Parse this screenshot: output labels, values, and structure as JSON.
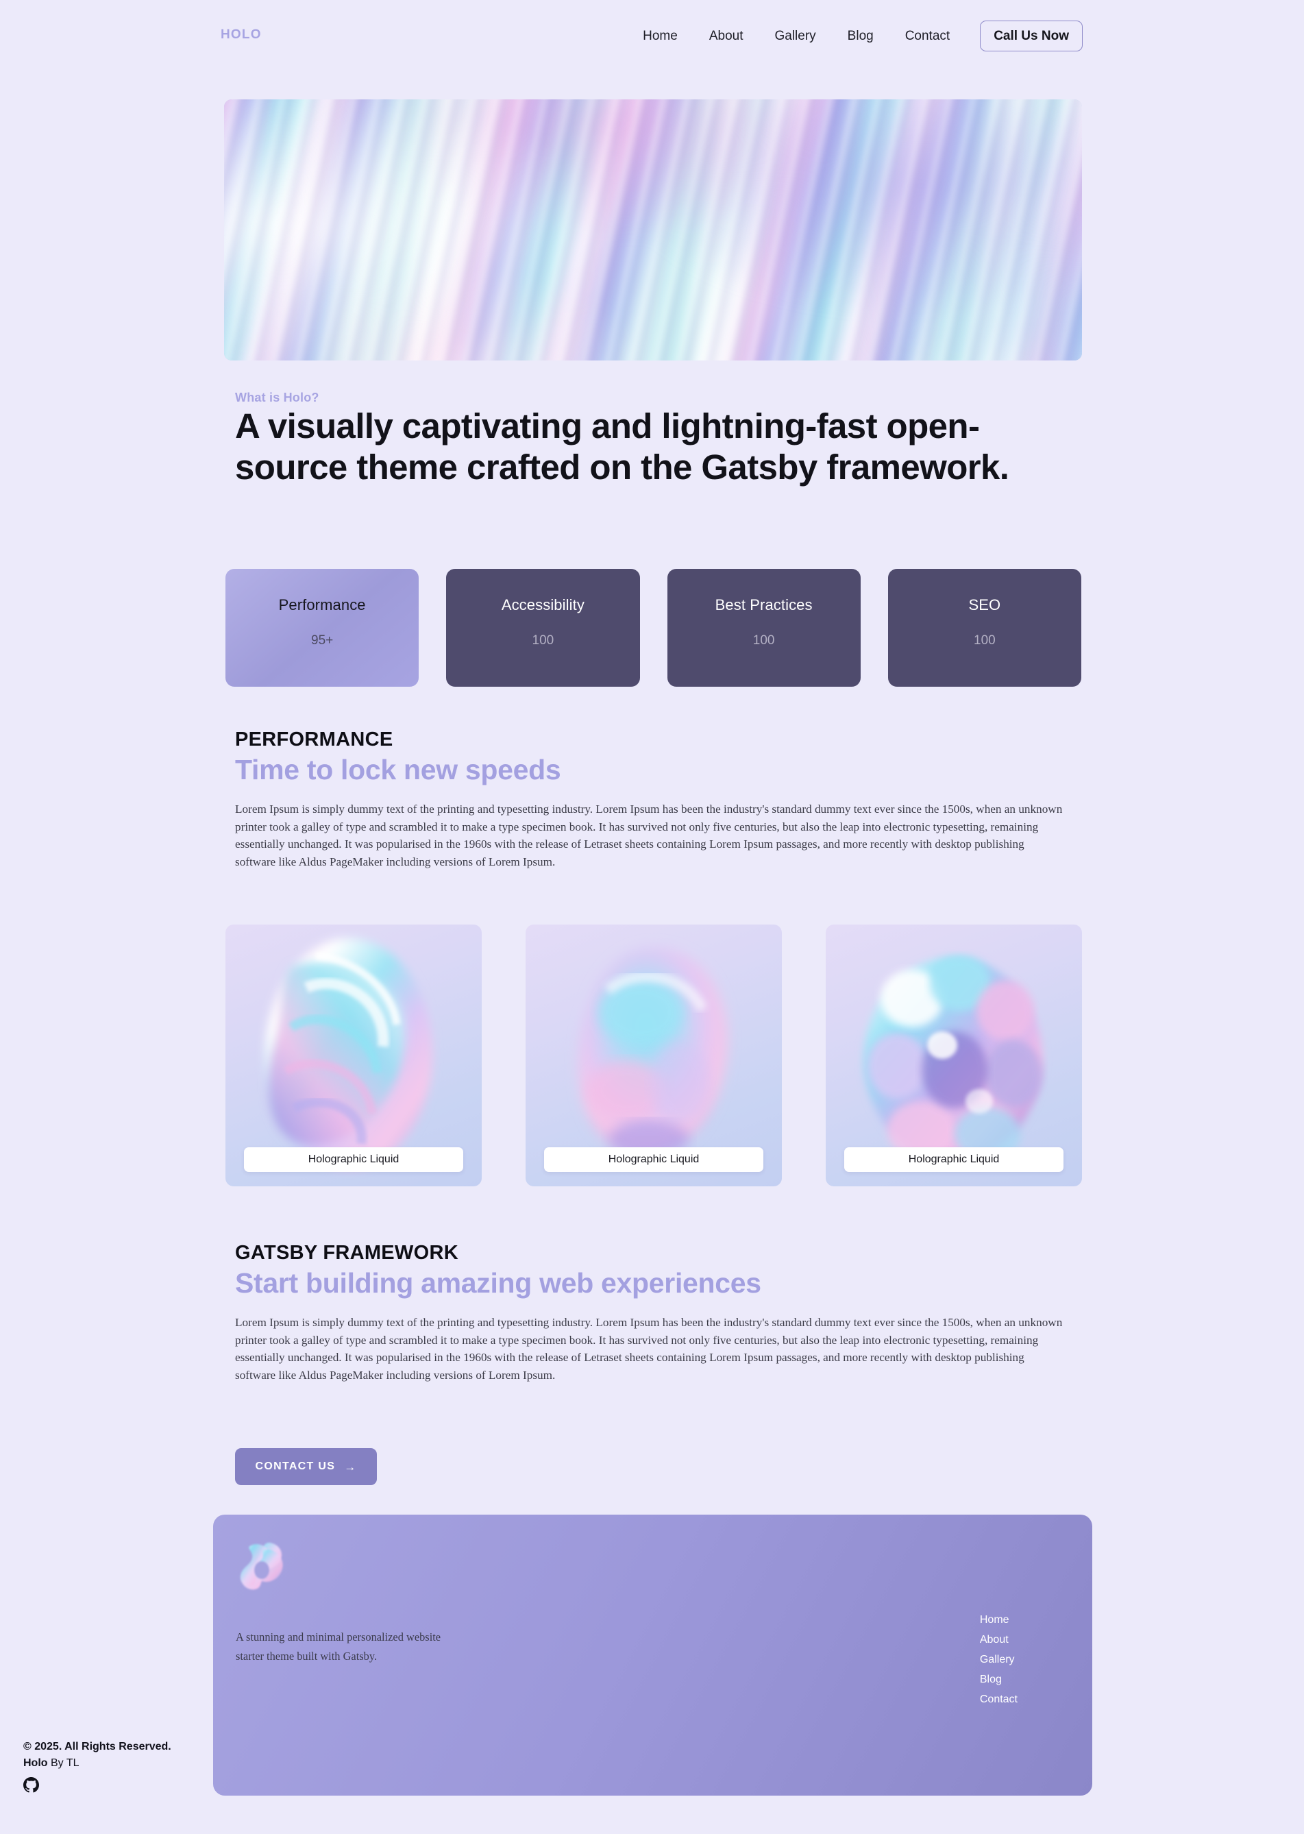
{
  "brand": {
    "name": "HOLO"
  },
  "nav": {
    "links": [
      "Home",
      "About",
      "Gallery",
      "Blog",
      "Contact"
    ],
    "cta_label": "Call Us Now"
  },
  "intro": {
    "eyebrow": "What is Holo?",
    "headline": "A visually captivating and lightning-fast open-source theme crafted on the Gatsby framework."
  },
  "metrics": [
    {
      "label": "Performance",
      "value": "95+",
      "theme": "light"
    },
    {
      "label": "Accessibility",
      "value": "100",
      "theme": "dark"
    },
    {
      "label": "Best Practices",
      "value": "100",
      "theme": "dark"
    },
    {
      "label": "SEO",
      "value": "100",
      "theme": "dark"
    }
  ],
  "performance_section": {
    "kicker": "PERFORMANCE",
    "title": "Time to lock new speeds",
    "body": "Lorem Ipsum is simply dummy text of the printing and typesetting industry. Lorem Ipsum has been the industry's standard dummy text ever since the 1500s, when an unknown printer took a galley of type and scrambled it to make a type specimen book. It has survived not only five centuries, but also the leap into electronic typesetting, remaining essentially unchanged. It was popularised in the 1960s with the release of Letraset sheets containing Lorem Ipsum passages, and more recently with desktop publishing software like Aldus PageMaker including versions of Lorem Ipsum."
  },
  "gallery": {
    "cards": [
      {
        "caption": "Holographic Liquid"
      },
      {
        "caption": "Holographic Liquid"
      },
      {
        "caption": "Holographic Liquid"
      }
    ]
  },
  "gatsby_section": {
    "kicker": "GATSBY FRAMEWORK",
    "title": "Start building amazing web experiences",
    "body": "Lorem Ipsum is simply dummy text of the printing and typesetting industry. Lorem Ipsum has been the industry's standard dummy text ever since the 1500s, when an unknown printer took a galley of type and scrambled it to make a type specimen book. It has survived not only five centuries, but also the leap into electronic typesetting, remaining essentially unchanged. It was popularised in the 1960s with the release of Letraset sheets containing Lorem Ipsum passages, and more recently with desktop publishing software like Aldus PageMaker including versions of Lorem Ipsum.",
    "button_label": "CONTACT US",
    "button_arrow": "→"
  },
  "footer": {
    "tagline": "A stunning and minimal personalized website starter theme built with Gatsby.",
    "links": [
      "Home",
      "About",
      "Gallery",
      "Blog",
      "Contact"
    ],
    "copyright": "© 2025. All Rights Reserved.",
    "byline_brand": "Holo",
    "byline_rest": " By TL",
    "social_icon": "github-icon"
  },
  "colors": {
    "page_bg": "#eceafa",
    "accent": "#a3a0e0",
    "accent_deep": "#8480c2",
    "card_dark": "#4f4b6d",
    "text": "#121219"
  }
}
